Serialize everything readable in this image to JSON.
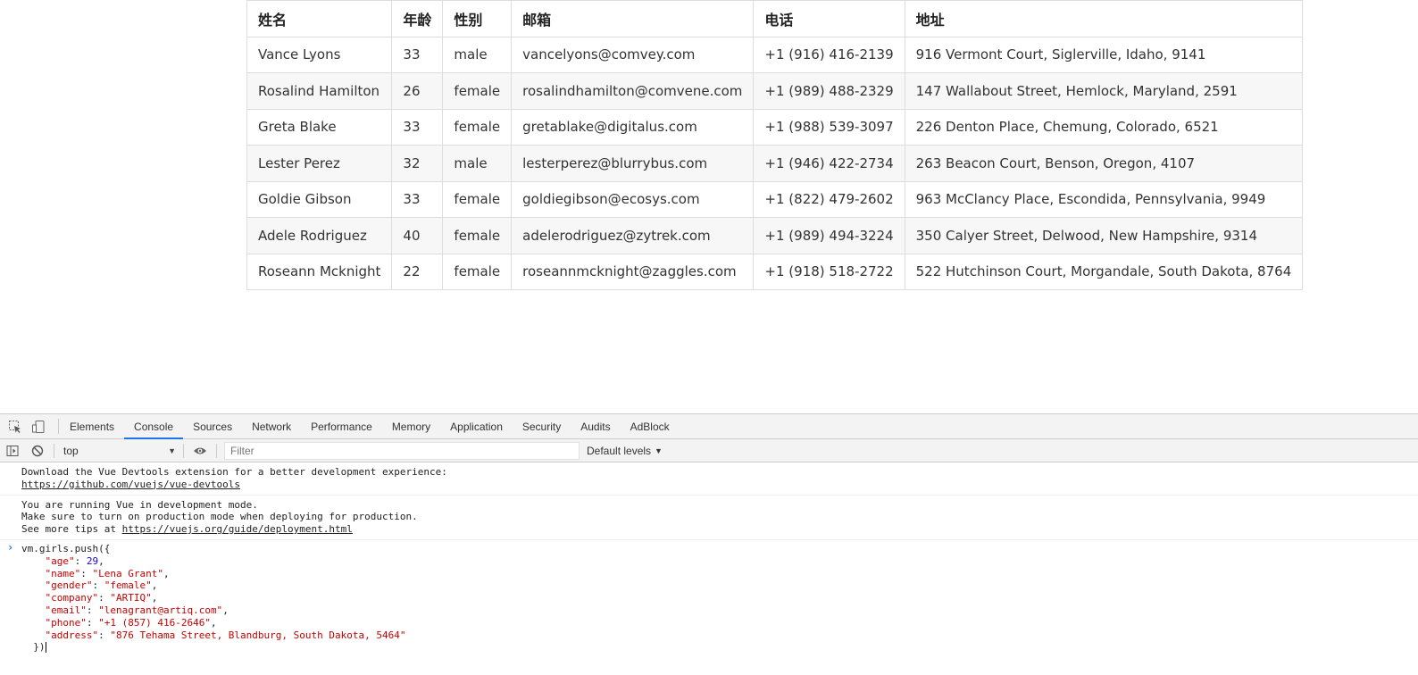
{
  "table": {
    "headers": [
      "姓名",
      "年龄",
      "性别",
      "邮箱",
      "电话",
      "地址"
    ],
    "rows": [
      [
        "Vance Lyons",
        "33",
        "male",
        "vancelyons@comvey.com",
        "+1 (916) 416-2139",
        "916 Vermont Court, Siglerville, Idaho, 9141"
      ],
      [
        "Rosalind Hamilton",
        "26",
        "female",
        "rosalindhamilton@comvene.com",
        "+1 (989) 488-2329",
        "147 Wallabout Street, Hemlock, Maryland, 2591"
      ],
      [
        "Greta Blake",
        "33",
        "female",
        "gretablake@digitalus.com",
        "+1 (988) 539-3097",
        "226 Denton Place, Chemung, Colorado, 6521"
      ],
      [
        "Lester Perez",
        "32",
        "male",
        "lesterperez@blurrybus.com",
        "+1 (946) 422-2734",
        "263 Beacon Court, Benson, Oregon, 4107"
      ],
      [
        "Goldie Gibson",
        "33",
        "female",
        "goldiegibson@ecosys.com",
        "+1 (822) 479-2602",
        "963 McClancy Place, Escondida, Pennsylvania, 9949"
      ],
      [
        "Adele Rodriguez",
        "40",
        "female",
        "adelerodriguez@zytrek.com",
        "+1 (989) 494-3224",
        "350 Calyer Street, Delwood, New Hampshire, 9314"
      ],
      [
        "Roseann Mcknight",
        "22",
        "female",
        "roseannmcknight@zaggles.com",
        "+1 (918) 518-2722",
        "522 Hutchinson Court, Morgandale, South Dakota, 8764"
      ]
    ]
  },
  "devtools": {
    "tabs": [
      "Elements",
      "Console",
      "Sources",
      "Network",
      "Performance",
      "Memory",
      "Application",
      "Security",
      "Audits",
      "AdBlock"
    ],
    "active_tab": "Console",
    "toolbar": {
      "context": "top",
      "filter_placeholder": "Filter",
      "filter_value": "",
      "levels": "Default levels"
    },
    "messages": [
      {
        "line1": "Download the Vue Devtools extension for a better development experience:",
        "link": "https://github.com/vuejs/vue-devtools"
      },
      {
        "line1": "You are running Vue in development mode.",
        "line2": "Make sure to turn on production mode when deploying for production.",
        "line3_prefix": "See more tips at ",
        "link": "https://vuejs.org/guide/deployment.html"
      }
    ],
    "input": {
      "first": "vm.girls.push({",
      "fields": [
        {
          "key": "\"age\"",
          "value": "29",
          "type": "number"
        },
        {
          "key": "\"name\"",
          "value": "\"Lena Grant\"",
          "type": "string"
        },
        {
          "key": "\"gender\"",
          "value": "\"female\"",
          "type": "string"
        },
        {
          "key": "\"company\"",
          "value": "\"ARTIQ\"",
          "type": "string"
        },
        {
          "key": "\"email\"",
          "value": "\"lenagrant@artiq.com\"",
          "type": "string"
        },
        {
          "key": "\"phone\"",
          "value": "\"+1 (857) 416-2646\"",
          "type": "string"
        },
        {
          "key": "\"address\"",
          "value": "\"876 Tehama Street, Blandburg, South Dakota, 5464\"",
          "type": "string"
        }
      ],
      "last": "})"
    }
  },
  "icons": {
    "inspect": "inspect-element-icon",
    "device": "device-toolbar-icon",
    "sidebar": "console-sidebar-icon",
    "clear": "clear-console-icon",
    "eye": "live-expression-eye-icon",
    "prompt": "console-prompt-chevron-icon"
  },
  "colors": {
    "accent": "#1a73e8",
    "string": "#c80000",
    "number": "#1c00cf",
    "border": "#dddddd",
    "stripe": "#f7f7f7",
    "devtools_bar": "#f3f3f3"
  }
}
